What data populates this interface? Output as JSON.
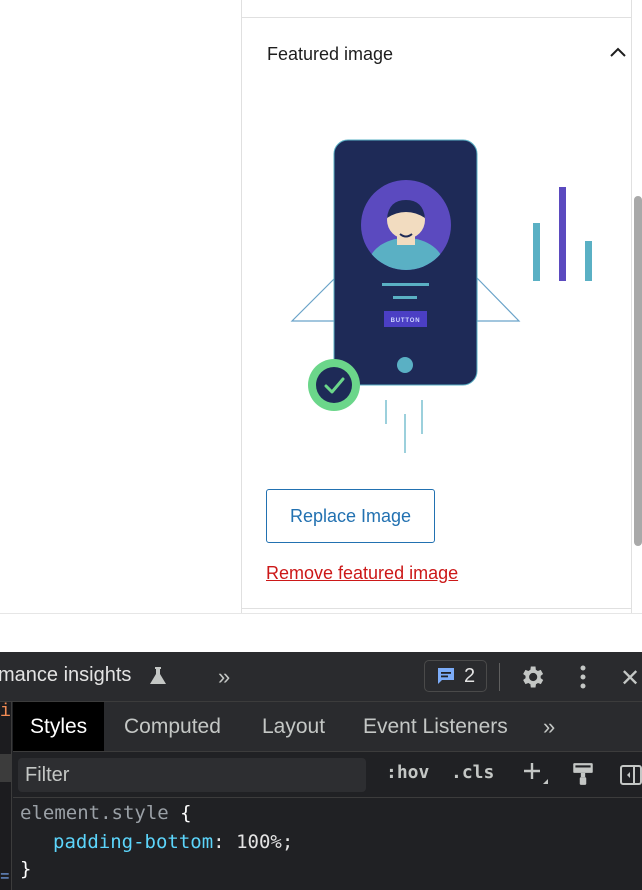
{
  "panel": {
    "title": "Featured image",
    "replace_label": "Replace Image",
    "remove_label": "Remove featured image",
    "illustration_button_text": "BUTTON"
  },
  "devtools": {
    "toolbar": {
      "title": "mance insights",
      "issues_count": "2"
    },
    "left_strip": {
      "i": "i",
      "eq": "="
    },
    "tabs": [
      {
        "label": "Styles",
        "active": true
      },
      {
        "label": "Computed",
        "active": false
      },
      {
        "label": "Layout",
        "active": false
      },
      {
        "label": "Event Listeners",
        "active": false
      }
    ],
    "more_tabs": "»",
    "filter": {
      "placeholder": "Filter"
    },
    "hov_label": ":hov",
    "cls_label": ".cls",
    "code": {
      "selector": "element.style",
      "open_brace": "{",
      "property": "padding-bottom",
      "colon": ":",
      "value": "100%",
      "semicolon": ";",
      "close_brace": "}"
    }
  },
  "colors": {
    "accent": "#2271b1",
    "danger": "#cc1818",
    "phone": "#1e2a57",
    "avatar_bg": "#5b4abf",
    "check_ring": "#6bd68a"
  }
}
